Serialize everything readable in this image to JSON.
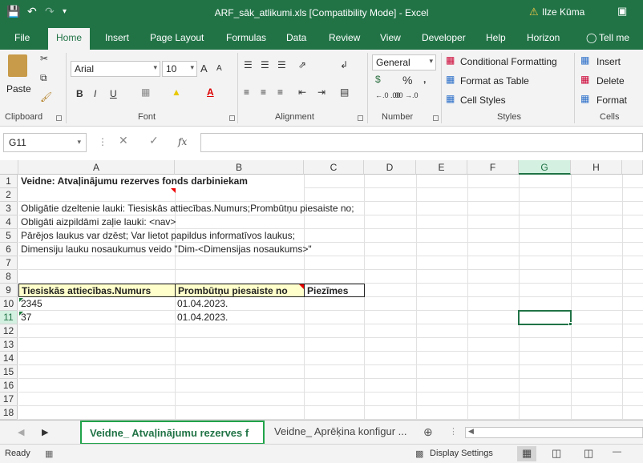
{
  "titlebar": {
    "title": "ARF_sāk_atlikumi.xls  [Compatibility Mode]  -  Excel",
    "user": "Ilze Kūma",
    "save_icon": "save-icon",
    "undo_icon": "undo-icon",
    "redo_icon": "redo-icon"
  },
  "tabs": [
    "File",
    "Home",
    "Insert",
    "Page Layout",
    "Formulas",
    "Data",
    "Review",
    "View",
    "Developer",
    "Help",
    "Horizon",
    "Tell me"
  ],
  "active_tab": "Home",
  "ribbon": {
    "clipboard": {
      "label": "Clipboard",
      "paste": "Paste"
    },
    "font": {
      "label": "Font",
      "name": "Arial",
      "size": "10",
      "bold": "B",
      "italic": "I",
      "underline": "U",
      "grow": "A",
      "shrink": "A"
    },
    "alignment": {
      "label": "Alignment"
    },
    "number": {
      "label": "Number",
      "format": "General",
      "percent": "%",
      "comma": ",",
      "inc_dec": "←.0 .00",
      "dec_dec": ".00 →.0",
      "currency": "$"
    },
    "styles": {
      "label": "Styles",
      "conditional": "Conditional Formatting",
      "format_table": "Format as Table",
      "cell_styles": "Cell Styles"
    },
    "cells": {
      "label": "Cells",
      "insert": "Insert",
      "delete": "Delete",
      "format": "Format"
    }
  },
  "formula_bar": {
    "name_box": "G11",
    "fx": "fx",
    "content": ""
  },
  "columns": [
    "A",
    "B",
    "C",
    "D",
    "E",
    "F",
    "G",
    "H"
  ],
  "selected_column": "G",
  "rows": [
    "1",
    "2",
    "3",
    "4",
    "5",
    "6",
    "7",
    "8",
    "9",
    "10",
    "11",
    "12",
    "13",
    "14",
    "15",
    "16",
    "17",
    "18"
  ],
  "selected_row": "11",
  "cells": {
    "r1": "Veidne: Atvaļinājumu rezerves fonds darbiniekam",
    "r3": "Obligātie dzeltenie lauki: Tiesiskās attiecības.Numurs;Prombūtņu piesaiste no;",
    "r4": "Obligāti aizpildāmi zaļie lauki: <nav>",
    "r5": "Pārējos laukus var dzēst; Var lietot papildus informatīvos laukus;",
    "r6": "Dimensiju lauku nosaukumus veido \"Dim-<Dimensijas nosaukums>\"",
    "h_a": "Tiesiskās attiecības.Numurs",
    "h_b": "Prombūtņu piesaiste no",
    "h_c": "Piezīmes",
    "r10a": "2345",
    "r10b": "01.04.2023.",
    "r11a": "37",
    "r11b": "01.04.2023."
  },
  "colors": {
    "header_yellow": "#ffffcc",
    "excel_green": "#217346",
    "sheet_tab_border": "#21a34a"
  },
  "sheets": {
    "active": "Veidne_ Atvaļinājumu rezerves f",
    "inactive": "Veidne_ Aprēķina konfigur ..."
  },
  "statusbar": {
    "ready": "Ready",
    "display_settings": "Display Settings"
  }
}
